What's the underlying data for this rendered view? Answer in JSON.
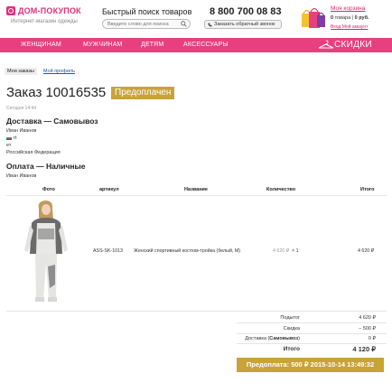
{
  "header": {
    "logo_text": "ДОМ-ПОКУПОК",
    "logo_sub": "Интернет-магазин одежды",
    "search_title": "Быстрый поиск товаров",
    "search_placeholder": "Введите слово для поиска",
    "phone": "8 800 700 08 83",
    "callback_label": "Заказать обратный звонок",
    "cart_title": "Моя корзина",
    "cart_count": "0",
    "cart_count_label": "товара",
    "cart_sum": "0 руб.",
    "login_link": "Вход Мой аккаунт"
  },
  "nav": {
    "items": [
      "ЖЕНЩИНАМ",
      "МУЖЧИНАМ",
      "ДЕТЯМ",
      "АКСЕССУАРЫ"
    ],
    "sale_label": "СКИДКИ"
  },
  "tabs": {
    "my_orders": "Мои заказы",
    "my_profile": "Мой профиль"
  },
  "order": {
    "title": "Заказ 10016535",
    "status": "Предоплачен",
    "date": "Сегодня 14:44",
    "delivery_title": "Доставка — Самовывоз",
    "customer_name": "Иван Иванов",
    "address_line1": "rt",
    "address_line2": "ет",
    "country": "Российская Федерация",
    "payment_title": "Оплата — Наличные",
    "payment_name": "Иван Иванов"
  },
  "table": {
    "headers": {
      "photo": "Фото",
      "sku": "артикул",
      "name": "Название",
      "qty": "Количество",
      "total": "Итого"
    },
    "rows": [
      {
        "sku": "ASS-SK-1013",
        "name": "Женский спортивный костюм-тройка (белый, M)",
        "price": "4 620 ₽",
        "qty": "× 1",
        "total": "4 620 ₽"
      }
    ]
  },
  "summary": {
    "subtotal_label": "Подытог",
    "subtotal_value": "4 620 ₽",
    "discount_label": "Скидка",
    "discount_value": "− 500 ₽",
    "delivery_label_prefix": "Доставка (",
    "delivery_label_bold": "Самовывоз",
    "delivery_label_suffix": ")",
    "delivery_value": "0 ₽",
    "total_label": "Итого",
    "total_value": "4 120 ₽",
    "paid_text": "Предоплата: 500 ₽ 2015-10-14 13:49:32"
  },
  "colors": {
    "brand_pink": "#e8407f",
    "status_gold": "#c9a239",
    "link_blue": "#1a5aa6"
  }
}
